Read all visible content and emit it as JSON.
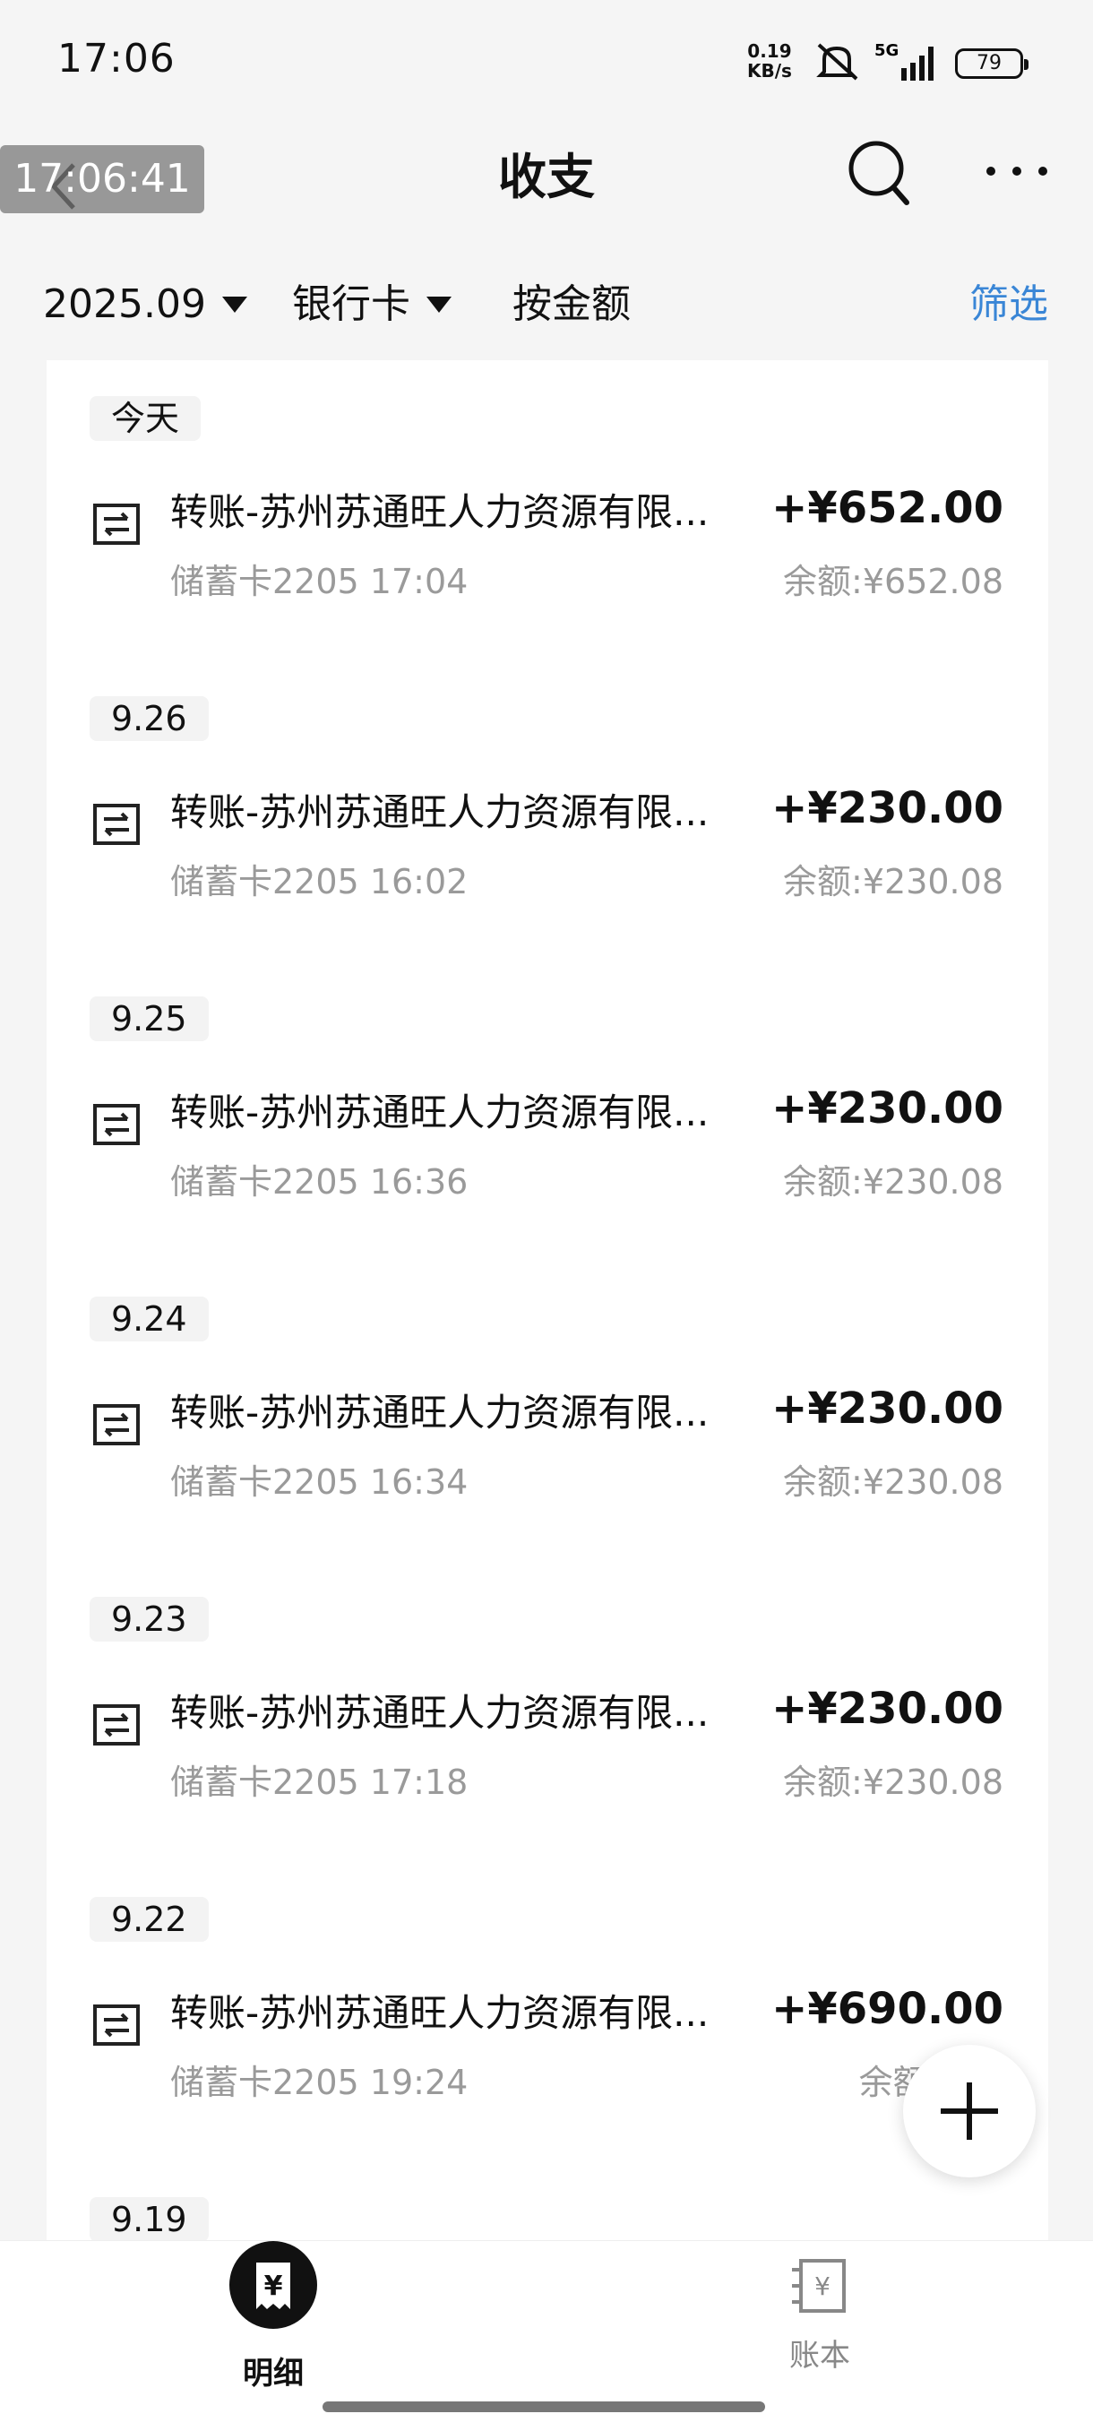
{
  "status_bar": {
    "time": "17:06",
    "net_speed_value": "0.19",
    "net_speed_unit": "KB/s",
    "network": "5G",
    "battery": "79"
  },
  "topbar": {
    "overlay_time": "17:06:41",
    "title": "收支"
  },
  "filters": {
    "month": "2025.09",
    "account": "银行卡",
    "sort": "按金额",
    "filter_label": "筛选"
  },
  "groups": [
    {
      "date": "今天",
      "title": "转账-苏州苏通旺人力资源有限...",
      "account_time": "储蓄卡2205 17:04",
      "amount": "+¥652.00",
      "balance": "余额:¥652.08"
    },
    {
      "date": "9.26",
      "title": "转账-苏州苏通旺人力资源有限...",
      "account_time": "储蓄卡2205 16:02",
      "amount": "+¥230.00",
      "balance": "余额:¥230.08"
    },
    {
      "date": "9.25",
      "title": "转账-苏州苏通旺人力资源有限...",
      "account_time": "储蓄卡2205 16:36",
      "amount": "+¥230.00",
      "balance": "余额:¥230.08"
    },
    {
      "date": "9.24",
      "title": "转账-苏州苏通旺人力资源有限...",
      "account_time": "储蓄卡2205 16:34",
      "amount": "+¥230.00",
      "balance": "余额:¥230.08"
    },
    {
      "date": "9.23",
      "title": "转账-苏州苏通旺人力资源有限...",
      "account_time": "储蓄卡2205 17:18",
      "amount": "+¥230.00",
      "balance": "余额:¥230.08"
    },
    {
      "date": "9.22",
      "title": "转账-苏州苏通旺人力资源有限...",
      "account_time": "储蓄卡2205 19:24",
      "amount": "+¥690.00",
      "balance": "余额:¥69"
    },
    {
      "date": "9.19"
    }
  ],
  "bottom_nav": {
    "detail_label": "明细",
    "book_label": "账本",
    "currency_glyph": "¥"
  },
  "colors": {
    "accent": "#3a86d6",
    "muted_text": "#9a9a9a"
  }
}
